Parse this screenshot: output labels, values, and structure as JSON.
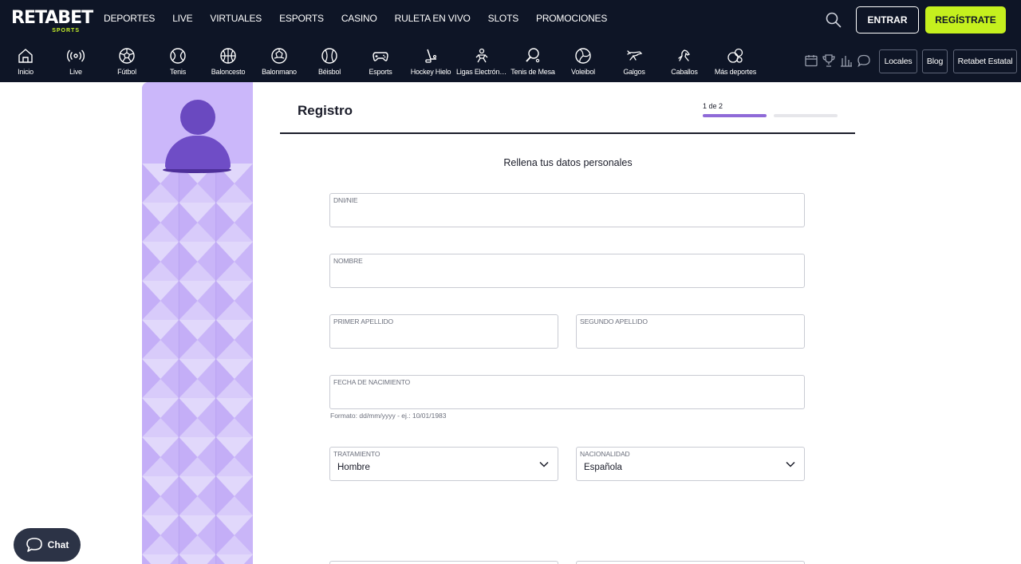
{
  "brand": {
    "logo_text": "RETABET",
    "logo_sub": "SPORTS",
    "accent_color": "#c5f01e",
    "header_bg": "#0e1526",
    "primary_purple": "#8f6ad8"
  },
  "header": {
    "nav": [
      "DEPORTES",
      "LIVE",
      "VIRTUALES",
      "ESPORTS",
      "CASINO",
      "RULETA EN VIVO",
      "SLOTS",
      "PROMOCIONES"
    ],
    "login_label": "ENTRAR",
    "register_label": "REGÍSTRATE",
    "search_icon": "search-icon"
  },
  "sports_nav": [
    {
      "label": "Inicio",
      "icon": "home-icon"
    },
    {
      "label": "Live",
      "icon": "live-broadcast-icon"
    },
    {
      "label": "Fútbol",
      "icon": "soccer-ball-icon"
    },
    {
      "label": "Tenis",
      "icon": "tennis-ball-icon"
    },
    {
      "label": "Baloncesto",
      "icon": "basketball-icon"
    },
    {
      "label": "Balonmano",
      "icon": "handball-icon"
    },
    {
      "label": "Béisbol",
      "icon": "baseball-icon"
    },
    {
      "label": "Esports",
      "icon": "gamepad-icon"
    },
    {
      "label": "Hockey Hielo",
      "icon": "hockey-icon"
    },
    {
      "label": "Ligas Electrónicas",
      "icon": "e-league-icon"
    },
    {
      "label": "Tenis de Mesa",
      "icon": "ping-pong-icon"
    },
    {
      "label": "Voleibol",
      "icon": "volleyball-icon"
    },
    {
      "label": "Galgos",
      "icon": "greyhound-icon"
    },
    {
      "label": "Caballos",
      "icon": "horse-icon"
    },
    {
      "label": "Más deportes",
      "icon": "more-sports-icon"
    }
  ],
  "utility": {
    "icons": [
      "calendar-icon",
      "trophy-icon",
      "stats-icon",
      "chat-bubble-icon"
    ],
    "locales_label": "Locales",
    "blog_label": "Blog",
    "estatal_label": "Retabet Estatal"
  },
  "form": {
    "title": "Registro",
    "step_text": "1 de 2",
    "step_progress": 0.5,
    "subtitle": "Rellena tus datos personales",
    "dni_label": "DNI/NIE",
    "dni_value": "",
    "nombre_label": "NOMBRE",
    "nombre_value": "",
    "apellido1_label": "PRIMER APELLIDO",
    "apellido1_value": "",
    "apellido2_label": "SEGUNDO APELLIDO",
    "apellido2_value": "",
    "fecha_label": "FECHA DE NACIMIENTO",
    "fecha_value": "",
    "fecha_hint": "Formato: dd/mm/yyyy - ej.: 10/01/1983",
    "tratamiento_label": "TRATAMIENTO",
    "tratamiento_value": "Hombre",
    "nacionalidad_label": "NACIONALIDAD",
    "nacionalidad_value": "Española"
  },
  "chat": {
    "label": "Chat"
  }
}
